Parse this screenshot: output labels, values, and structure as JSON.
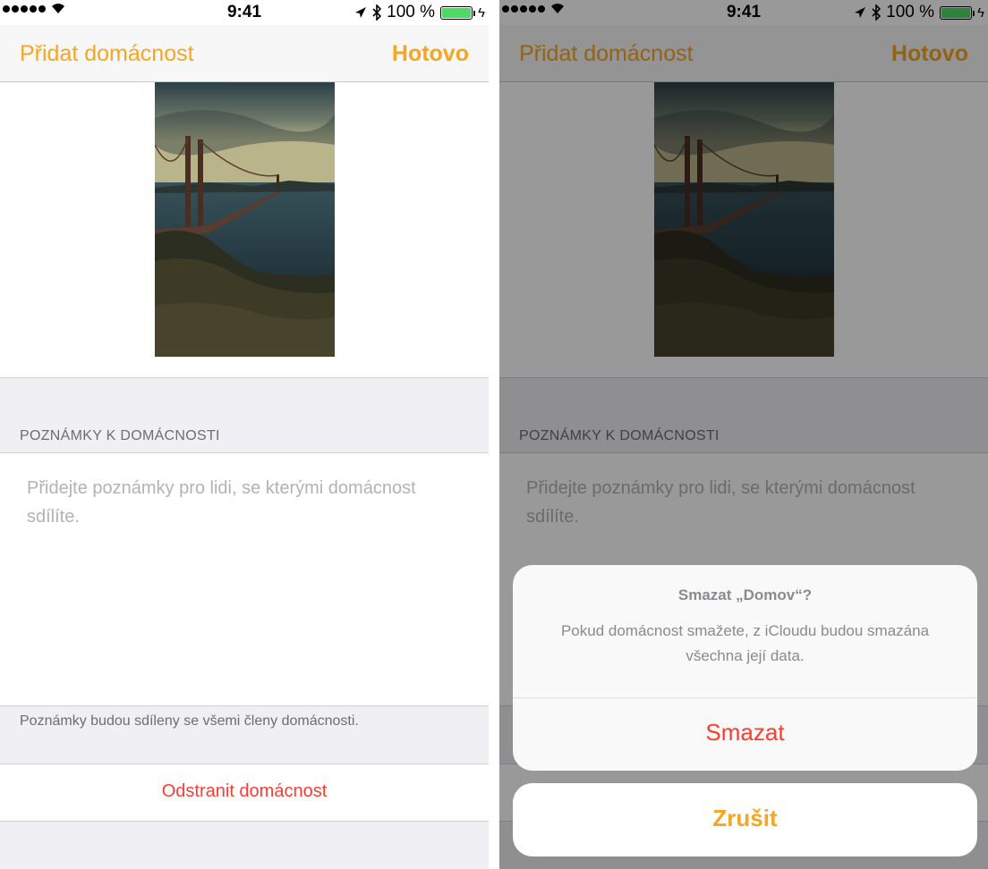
{
  "status": {
    "time": "9:41",
    "battery_percent": "100 %",
    "bluetooth": "✱",
    "location": "➤"
  },
  "nav": {
    "title": "Přidat domácnost",
    "done": "Hotovo"
  },
  "notes": {
    "header": "POZNÁMKY K DOMÁCNOSTI",
    "placeholder": "Přidejte poznámky pro lidi, se kterými domácnost sdílíte.",
    "footer": "Poznámky budou sdíleny se všemi členy domácnosti."
  },
  "delete_home_label": "Odstranit domácnost",
  "action_sheet": {
    "title": "Smazat „Domov“?",
    "message": "Pokud domácnost smažete, z iCloudu budou smazána všechna její data.",
    "delete_label": "Smazat",
    "cancel_label": "Zrušit"
  },
  "colors": {
    "accent": "#f5a623",
    "destructive": "#ff3b30",
    "grouped_background": "#efeff4"
  },
  "icons": [
    "signal-dots-icon",
    "wifi-icon",
    "location-arrow-icon",
    "bluetooth-icon",
    "battery-icon",
    "charging-bolt-icon"
  ]
}
